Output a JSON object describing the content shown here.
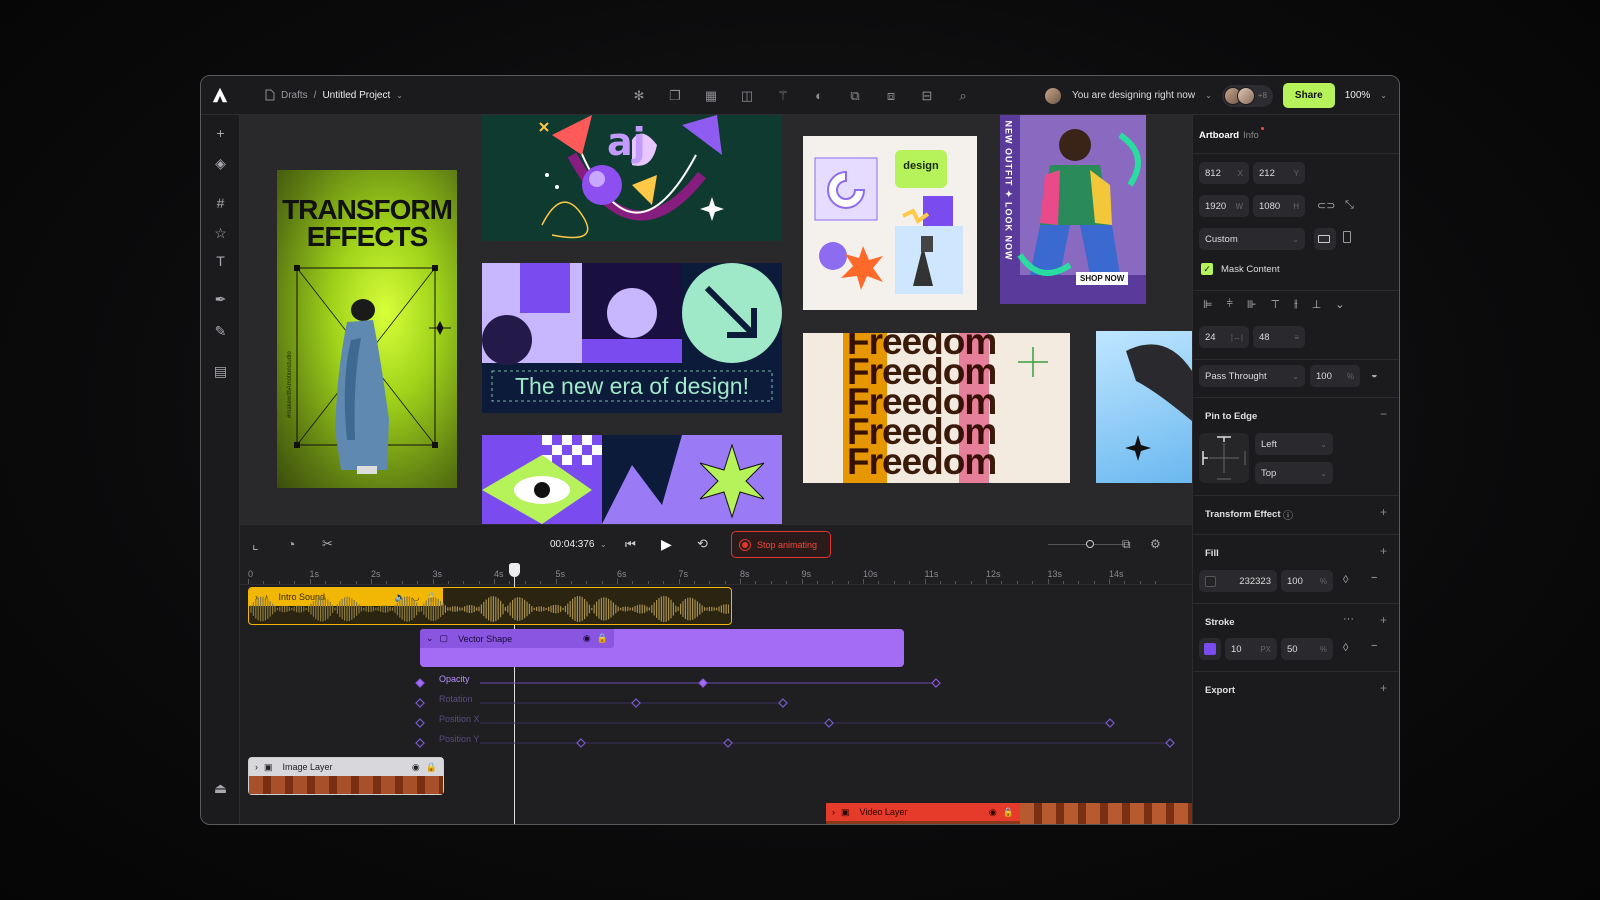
{
  "breadcrumb": {
    "parent": "Drafts",
    "separator": "/",
    "current": "Untitled Project"
  },
  "topbar": {
    "presence": "You are designing right now",
    "collab_count": "+8",
    "share_label": "Share",
    "zoom": "100%"
  },
  "artboards": {
    "poster_title_line1": "TRANSFORM",
    "poster_title_line2": "EFFECTS",
    "poster_side_text": "#makewithAmotionstudio",
    "banner_text": "The new era of design!",
    "sticker_text": "design",
    "fashion_vertical_text": "NEW OUTFIT ✦ LOOK NOW",
    "fashion_shop_text": "SHOP NOW",
    "freedom_word": "Freedom"
  },
  "timeline": {
    "time": "00:04:376",
    "stop_label": "Stop animating",
    "ticks": [
      "0",
      "1s",
      "2s",
      "3s",
      "4s",
      "5s",
      "6s",
      "7s",
      "8s",
      "9s",
      "10s",
      "11s",
      "12s",
      "13s",
      "14s"
    ],
    "tracks": {
      "intro": "Intro Sound",
      "vector": "Vector Shape",
      "image": "Image Layer",
      "video": "Video Layer"
    },
    "keyframes": [
      "Opacity",
      "Rotation",
      "Position X",
      "Position Y"
    ]
  },
  "panel": {
    "tabs": {
      "artboard": "Artboard",
      "info": "Info"
    },
    "x": "812",
    "x_unit": "X",
    "y": "212",
    "y_unit": "Y",
    "w": "1920",
    "w_unit": "W",
    "h": "1080",
    "h_unit": "H",
    "preset": "Custom",
    "mask_label": "Mask Content",
    "spacing_a": "24",
    "spacing_b": "48",
    "blend": "Pass Throught",
    "opacity": "100",
    "opacity_unit": "%",
    "pin_title": "Pin to Edge",
    "pin_h": "Left",
    "pin_v": "Top",
    "transform_title": "Transform Effect",
    "fill_title": "Fill",
    "fill_hex": "232323",
    "fill_opacity": "100",
    "fill_unit": "%",
    "stroke_title": "Stroke",
    "stroke_width": "10",
    "stroke_unit": "PX",
    "stroke_opacity": "50",
    "stroke_op_unit": "%",
    "export_title": "Export"
  },
  "colors": {
    "accent": "#b6f25a",
    "purple": "#a46cf5",
    "stop_red": "#e0382b",
    "intro_yellow": "#f2b705",
    "video_red": "#e63a2a"
  }
}
